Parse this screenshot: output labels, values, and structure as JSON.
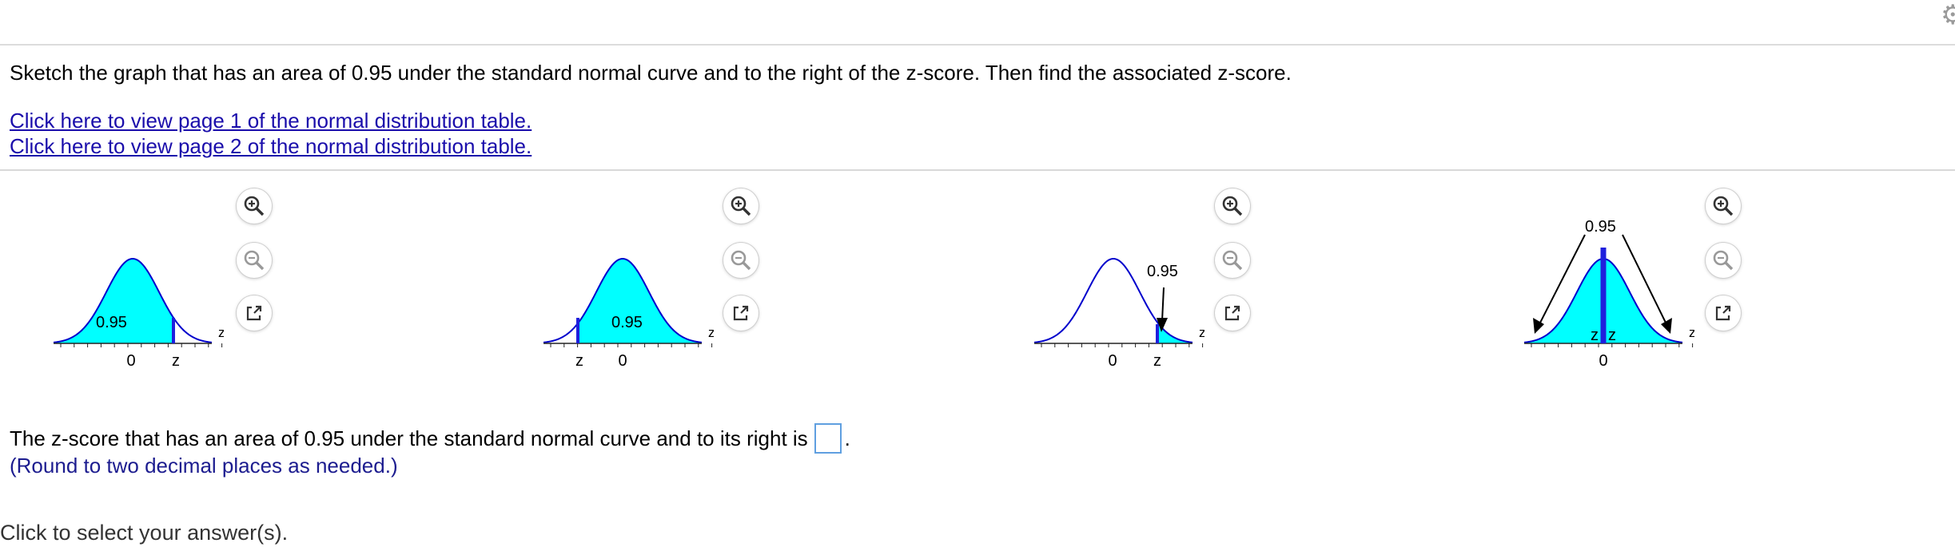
{
  "question": "Sketch the graph that has an area of 0.95 under the standard normal curve and to the right of the z-score. Then find the associated z-score.",
  "links": [
    "Click here to view page 1 of the normal distribution table.",
    "Click here to view page 2 of the normal distribution table."
  ],
  "graph_options": [
    {
      "area_label": "0.95",
      "shading": "left-of-z",
      "z_label": "z",
      "zero_label": "0",
      "axis_label": "z"
    },
    {
      "area_label": "0.95",
      "shading": "right-of-z",
      "z_label": "z",
      "zero_label": "0",
      "axis_label": "z"
    },
    {
      "area_label": "0.95",
      "shading": "right-tail-arrow",
      "z_label": "z",
      "zero_label": "0",
      "axis_label": "z"
    },
    {
      "area_label": "0.95",
      "shading": "all-with-two-tails",
      "z_label": "z",
      "z_label_2": "z",
      "zero_label": "0",
      "axis_label": "z"
    }
  ],
  "tools": {
    "zoom_in": "zoom-in-icon",
    "zoom_out": "zoom-out-icon",
    "popout": "popout-icon"
  },
  "answer": {
    "prompt": "The z-score that has an area of 0.95 under the standard normal curve and to its right is",
    "value": "",
    "suffix": ".",
    "hint": "(Round to two decimal places as needed.)"
  },
  "footer": "Click to select your answer(s).",
  "colors": {
    "fill": "#00ffff",
    "curve": "#0000cc",
    "marker": "#1f1fdd",
    "link": "#1a0dab",
    "hint": "#1c1c8f"
  }
}
